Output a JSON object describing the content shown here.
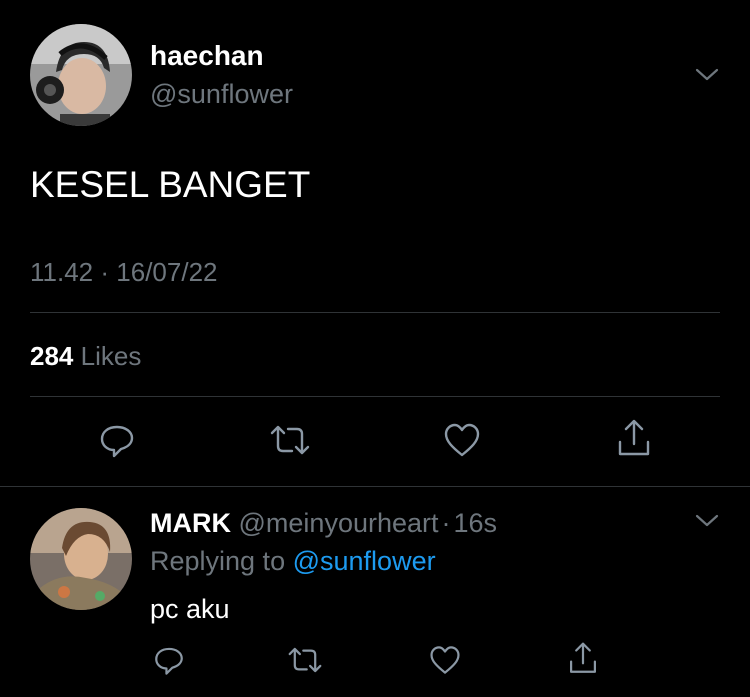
{
  "colors": {
    "background": "#000000",
    "text": "#ffffff",
    "muted": "#6e767d",
    "link": "#1d9bf0",
    "divider": "#2f3336"
  },
  "tweet": {
    "name": "haechan",
    "handle": "@sunflower",
    "text": "KESEL BANGET",
    "time": "11.42",
    "separator": "·",
    "date": "16/07/22",
    "likes_count": "284",
    "likes_label": "Likes",
    "menu_icon": "chevron-down-icon"
  },
  "actions": {
    "icons": [
      "reply-icon",
      "retweet-icon",
      "like-icon",
      "share-icon"
    ]
  },
  "reply": {
    "name": "MARK",
    "handle": "@meinyourheart",
    "separator": "·",
    "time": "16s",
    "replying_prefix": "Replying to",
    "replying_handle": "@sunflower",
    "text": "pc aku",
    "menu_icon": "chevron-down-icon"
  }
}
